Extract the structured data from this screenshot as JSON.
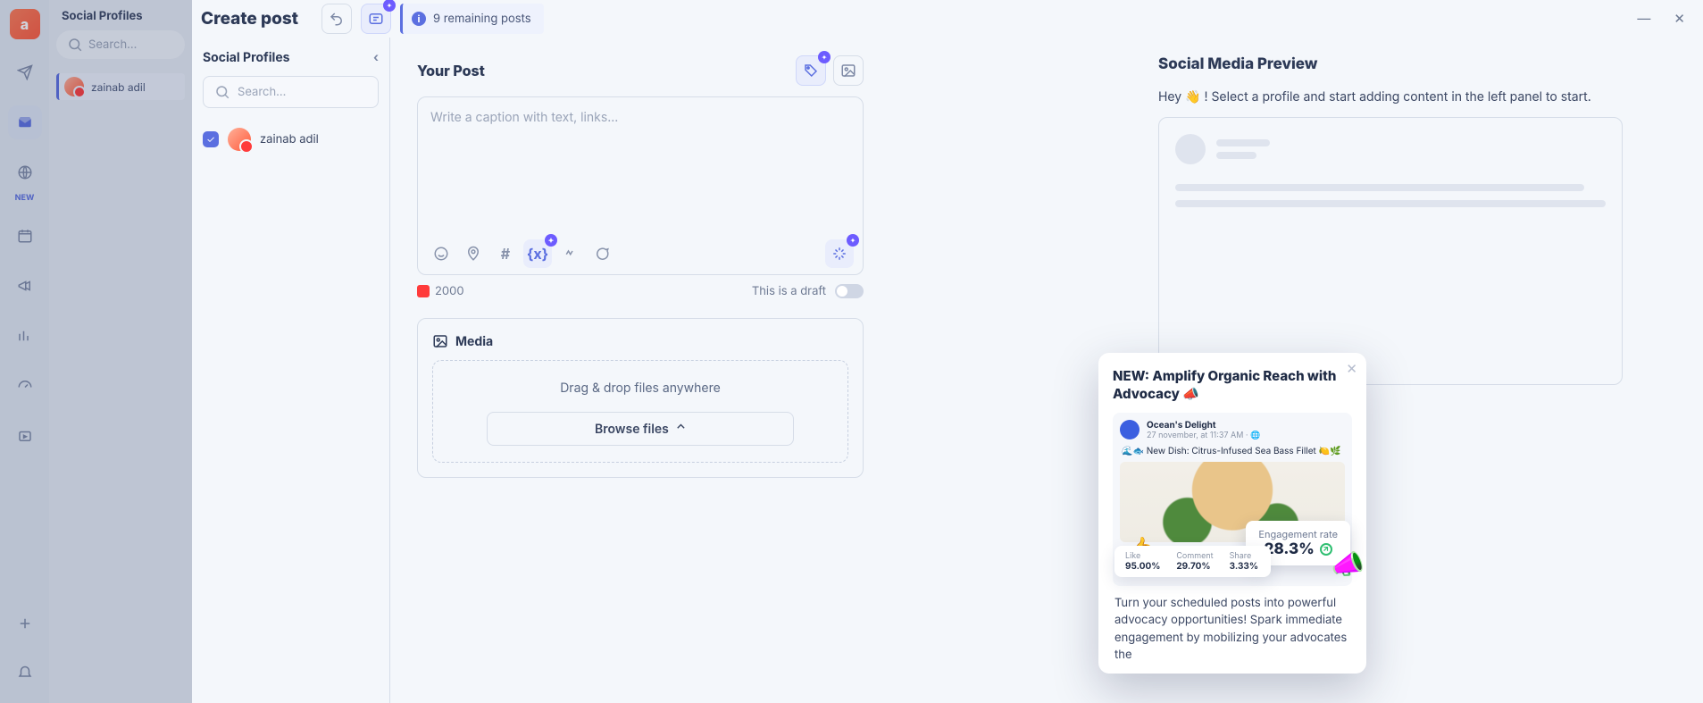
{
  "rail": {
    "new_label": "NEW"
  },
  "mini_sidebar": {
    "title": "Social Profiles",
    "search_placeholder": "Search...",
    "items": [
      {
        "name": "zainab adil"
      }
    ]
  },
  "composer": {
    "title": "Create post",
    "remaining": "9 remaining posts"
  },
  "profiles_panel": {
    "title": "Social Profiles",
    "search_placeholder": "Search...",
    "items": [
      {
        "name": "zainab adil",
        "checked": true
      }
    ]
  },
  "editor": {
    "heading": "Your Post",
    "caption_placeholder": "Write a caption with text, links...",
    "char_limit": "2000",
    "draft_label": "This is a draft",
    "media_heading": "Media",
    "drop_hint": "Drag & drop files anywhere",
    "browse_label": "Browse files"
  },
  "preview": {
    "heading": "Social Media Preview",
    "hint_prefix": "Hey ",
    "hint_suffix": " ! Select a profile and start adding content in the left panel to start."
  },
  "popup": {
    "title": "NEW: Amplify Organic Reach with Advocacy 📣",
    "promo": {
      "account": "Ocean's Delight",
      "timestamp": "27 november, at 11:37 AM · 🌐",
      "caption": "🌊🐟 New Dish: Citrus-Infused Sea Bass Fillet 🍋🌿",
      "engagement_label": "Engagement rate",
      "engagement_value": "28.3%",
      "metrics": [
        {
          "label": "Like",
          "value": "95.00%"
        },
        {
          "label": "Comment",
          "value": "29.70%"
        },
        {
          "label": "Share",
          "value": "3.33%"
        }
      ]
    },
    "body": "Turn your scheduled posts into powerful advocacy opportunities! Spark immediate engagement by mobilizing your advocates the"
  }
}
